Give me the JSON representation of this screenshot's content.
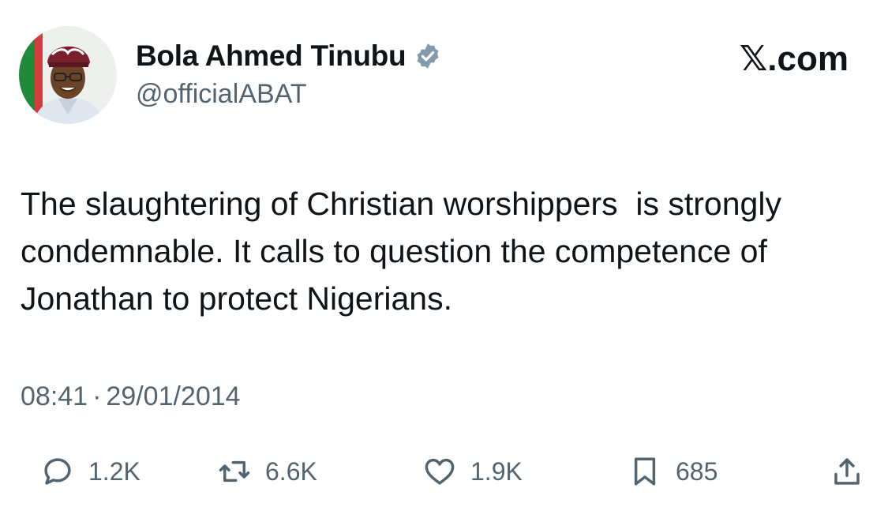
{
  "author": {
    "display_name": "Bola Ahmed Tinubu",
    "handle": "@officialABAT",
    "verified_icon": "verified-badge-icon",
    "avatar": "profile-photo"
  },
  "brand": {
    "label": "𝕏.com"
  },
  "tweet": {
    "text": "The slaughtering of Christian worshippers  is strongly condemnable. It calls to question the competence of Jonathan to protect Nigerians.",
    "time": "08:41",
    "separator": "·",
    "date": "29/01/2014"
  },
  "actions": {
    "reply": {
      "icon": "reply-icon",
      "count": "1.2K"
    },
    "retweet": {
      "icon": "retweet-icon",
      "count": "6.6K"
    },
    "like": {
      "icon": "heart-icon",
      "count": "1.9K"
    },
    "bookmark": {
      "icon": "bookmark-icon",
      "count": "685"
    },
    "share": {
      "icon": "share-icon"
    }
  },
  "colors": {
    "text_primary": "#0f1419",
    "text_secondary": "#536471",
    "verified_badge": "#829aab",
    "icon_stroke": "#536471"
  }
}
